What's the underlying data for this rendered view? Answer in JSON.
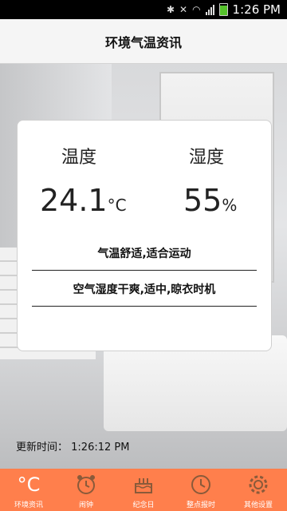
{
  "status_bar": {
    "time": "1:26 PM"
  },
  "app": {
    "title": "环境气温资讯"
  },
  "card": {
    "temperature_label": "温度",
    "temperature_value": "24.1",
    "temperature_unit": "°C",
    "humidity_label": "湿度",
    "humidity_value": "55",
    "humidity_unit": "%",
    "temperature_comment": "气温舒适,适合运动",
    "humidity_comment": "空气湿度干爽,适中,晾衣时机"
  },
  "update": {
    "label": "更新时间：",
    "time": "1:26:12 PM"
  },
  "tabs": [
    {
      "icon": "celsius-icon",
      "label": "环境资讯",
      "symbol": "°C"
    },
    {
      "icon": "alarm-clock-icon",
      "label": "闹钟"
    },
    {
      "icon": "cake-icon",
      "label": "纪念日"
    },
    {
      "icon": "clock-icon",
      "label": "整点报时"
    },
    {
      "icon": "gear-icon",
      "label": "其他设置"
    }
  ],
  "colors": {
    "tab_bar": "#ff7f4c",
    "status_bar": "#000000",
    "battery": "#55c22b"
  }
}
